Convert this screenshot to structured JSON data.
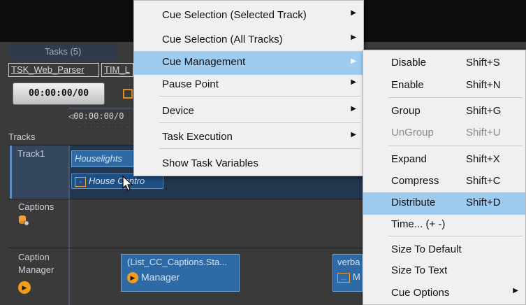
{
  "tasks": {
    "tab_label": "Tasks (5)",
    "items": [
      "TSK_Web_Parser",
      "TIM_L"
    ]
  },
  "timecode": "00:00:00/00",
  "ruler": {
    "start_label": "00:00:00/0"
  },
  "tracks": {
    "header": "Tracks",
    "rows": [
      {
        "label": "Track1"
      },
      {
        "label": "Captions"
      },
      {
        "label_line1": "Caption",
        "label_line2": "Manager"
      }
    ]
  },
  "cues": {
    "houselights_title": "Houselights",
    "houselights_sub": "House Contro",
    "captions_title": "(List_CC_Captions.Sta...",
    "captions_sub": "Manager",
    "verba_title": "verba",
    "verba_sub": "M"
  },
  "context_menu": {
    "items": [
      {
        "label": "Cue Selection (Selected Track)",
        "submenu": true
      },
      {
        "label": "Cue Selection (All Tracks)",
        "submenu": true
      },
      {
        "label": "Cue Management",
        "submenu": true,
        "highlighted": true
      },
      {
        "label": "Pause Point",
        "submenu": true
      },
      {
        "label": "Device",
        "submenu": true
      },
      {
        "label": "Task Execution",
        "submenu": true
      },
      {
        "label": "Show Task Variables",
        "submenu": false
      }
    ]
  },
  "submenu": {
    "items": [
      {
        "label": "Disable",
        "shortcut": "Shift+S"
      },
      {
        "label": "Enable",
        "shortcut": "Shift+N"
      },
      {
        "label": "Group",
        "shortcut": "Shift+G"
      },
      {
        "label": "UnGroup",
        "shortcut": "Shift+U",
        "disabled": true
      },
      {
        "label": "Expand",
        "shortcut": "Shift+X"
      },
      {
        "label": "Compress",
        "shortcut": "Shift+C"
      },
      {
        "label": "Distribute",
        "shortcut": "Shift+D",
        "highlighted": true
      },
      {
        "label": "Time... (+ -)",
        "shortcut": ""
      },
      {
        "label": "Size To Default",
        "shortcut": ""
      },
      {
        "label": "Size To Text",
        "shortcut": ""
      },
      {
        "label": "Cue Options",
        "shortcut": "",
        "submenu": true
      }
    ]
  },
  "icons": {
    "submenu_arrow": "▶",
    "cursor": "mouse-pointer-icon",
    "house_control": "device-box-icon",
    "manager": "play-circle-icon",
    "captions": "database-gear-icon"
  },
  "colors": {
    "highlight": "#9ecbf0",
    "accent_orange": "#f39c1a",
    "cue_blue": "#2e6aa6"
  }
}
